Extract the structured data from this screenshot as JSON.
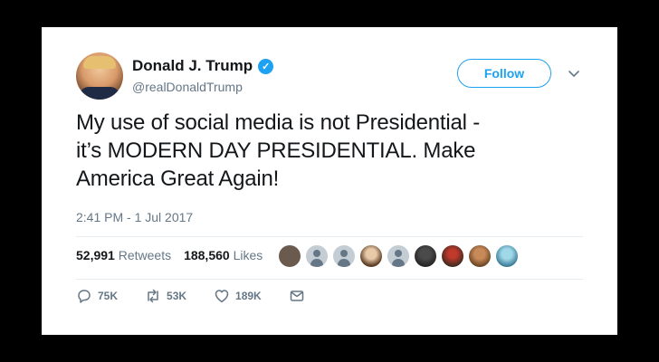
{
  "tweet": {
    "author_name": "Donald J. Trump",
    "handle": "@realDonaldTrump",
    "follow_label": "Follow",
    "text_line1": "My use of social media is not Presidential -",
    "text_line2": "it’s MODERN DAY PRESIDENTIAL. Make",
    "text_line3": "America Great Again!",
    "timestamp": "2:41 PM - 1 Jul 2017"
  },
  "stats": {
    "retweets_count": "52,991",
    "retweets_label": "Retweets",
    "likes_count": "188,560",
    "likes_label": "Likes"
  },
  "actions": {
    "replies": "75K",
    "retweets": "53K",
    "likes": "189K"
  },
  "colors": {
    "accent": "#1da1f2",
    "text": "#14171a",
    "muted": "#657786"
  },
  "likers": [
    "avatar",
    "default-avatar",
    "default-avatar",
    "avatar",
    "default-avatar",
    "avatar",
    "avatar",
    "avatar",
    "avatar"
  ]
}
